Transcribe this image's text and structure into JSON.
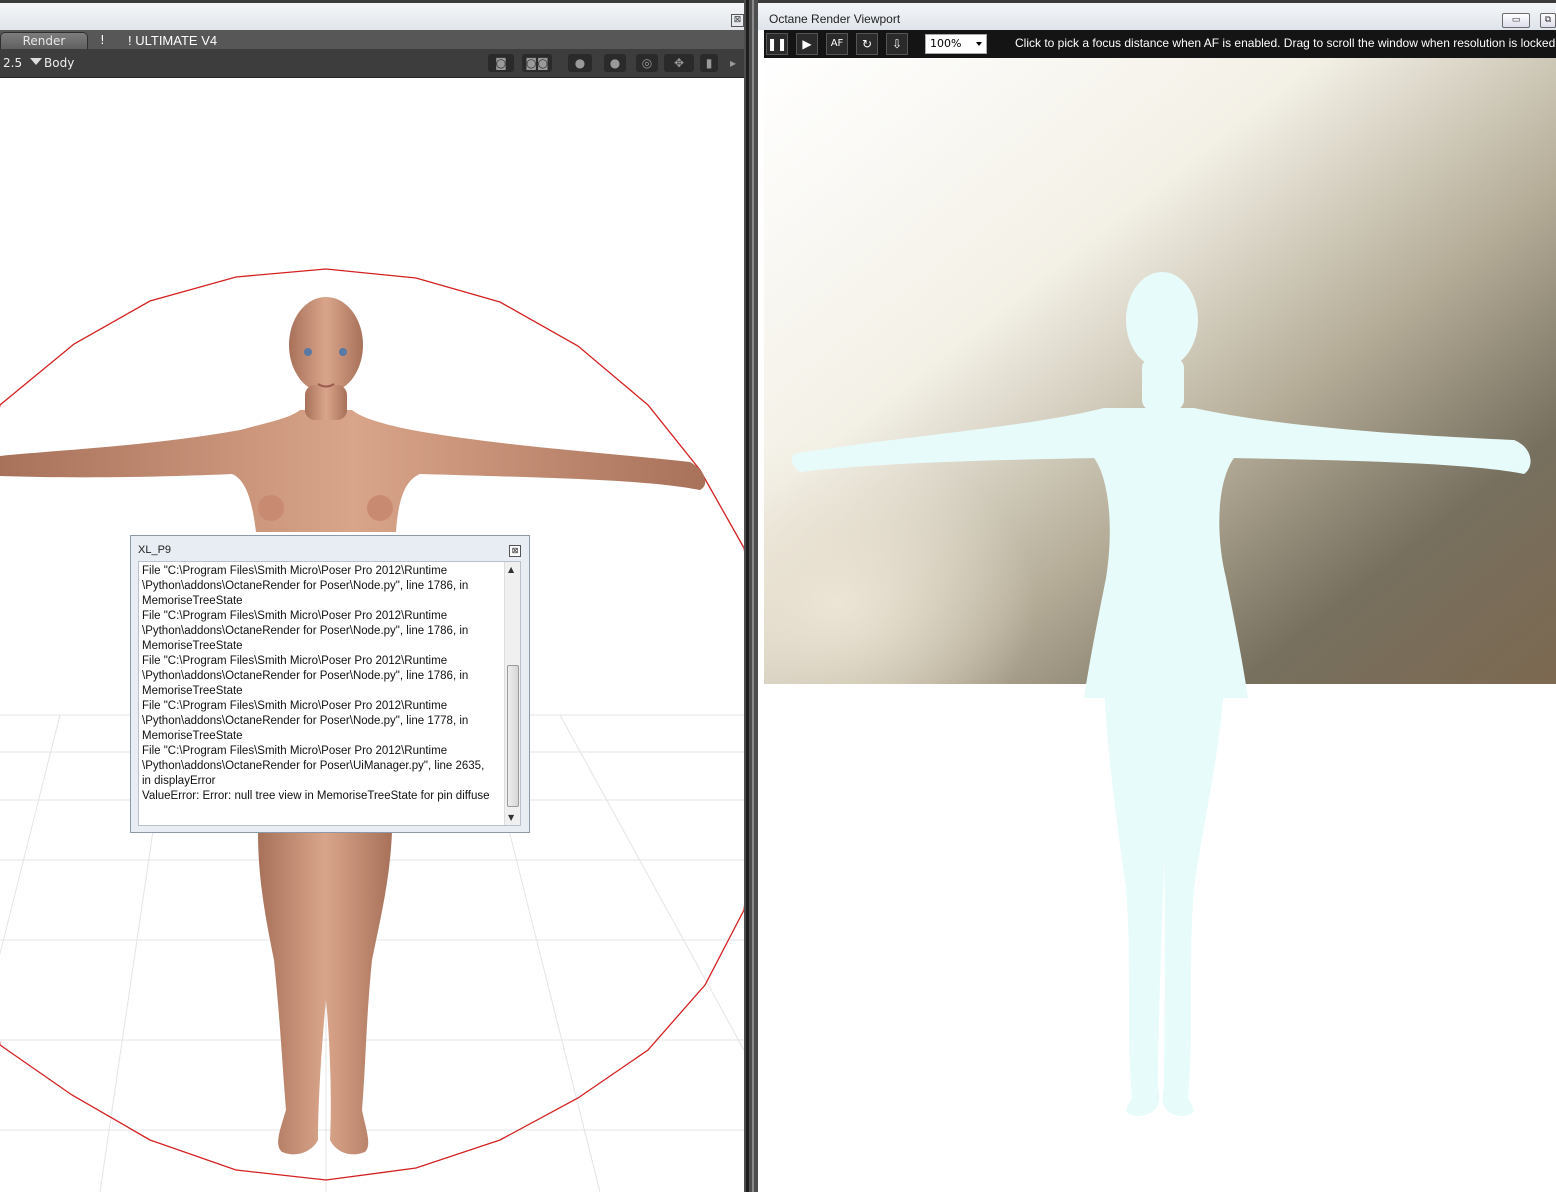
{
  "left_panel": {
    "tabs": [
      "Render",
      "!",
      "! ULTIMATE V4"
    ],
    "toolbar": {
      "scale_value": "2.5",
      "body_label": "Body"
    }
  },
  "error_dialog": {
    "title": "XL_P9",
    "lines": [
      "  File \"C:\\Program Files\\Smith Micro\\Poser Pro 2012\\Runtime",
      "\\Python\\addons\\OctaneRender for Poser\\Node.py\", line 1786, in",
      "MemoriseTreeState",
      "  File \"C:\\Program Files\\Smith Micro\\Poser Pro 2012\\Runtime",
      "\\Python\\addons\\OctaneRender for Poser\\Node.py\", line 1786, in",
      "MemoriseTreeState",
      "  File \"C:\\Program Files\\Smith Micro\\Poser Pro 2012\\Runtime",
      "\\Python\\addons\\OctaneRender for Poser\\Node.py\", line 1786, in",
      "MemoriseTreeState",
      "  File \"C:\\Program Files\\Smith Micro\\Poser Pro 2012\\Runtime",
      "\\Python\\addons\\OctaneRender for Poser\\Node.py\", line 1778, in",
      "MemoriseTreeState",
      "  File \"C:\\Program Files\\Smith Micro\\Poser Pro 2012\\Runtime",
      "\\Python\\addons\\OctaneRender for Poser\\UiManager.py\", line 2635,",
      "in displayError",
      "ValueError: Error: null tree view in MemoriseTreeState for pin diffuse"
    ]
  },
  "octane": {
    "window_title": "Octane Render Viewport",
    "zoom": "100%",
    "af_label": "AF",
    "hint": "Click to pick a focus distance when AF is enabled.  Drag to scroll the window when resolution is locked"
  },
  "colors": {
    "bounding_circle": "#d42020",
    "skin": "#c78f72",
    "render_figure": "#e8fbfb",
    "dialog_bg": "#e8edf3"
  }
}
